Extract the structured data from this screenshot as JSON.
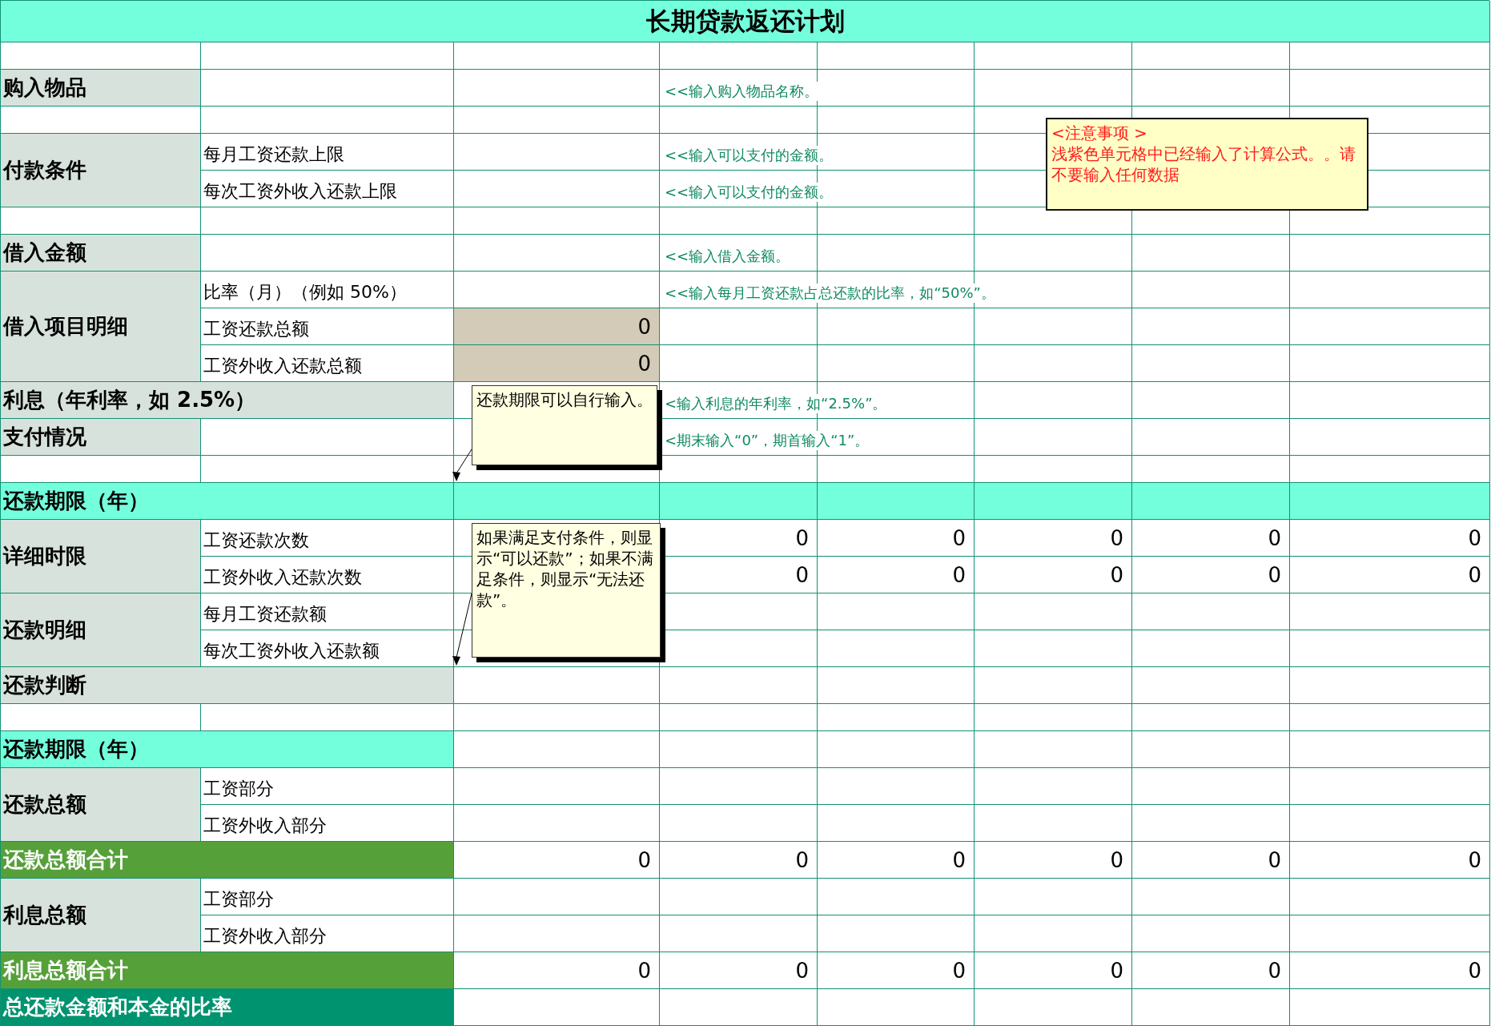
{
  "title": "长期贷款返还计划",
  "rows": [
    {
      "kind": "blank"
    },
    {
      "kind": "field",
      "label": "购入物品",
      "hint": "<<输入购入物品名称。"
    },
    {
      "kind": "blank"
    },
    {
      "kind": "group",
      "label": "付款条件",
      "items": [
        {
          "label": "每月工资还款上限",
          "hint": "<<输入可以支付的金额。"
        },
        {
          "label": "每次工资外收入还款上限",
          "hint": "<<输入可以支付的金额。"
        }
      ]
    },
    {
      "kind": "blank"
    },
    {
      "kind": "field",
      "label": "借入金额",
      "hint": "<<输入借入金额。"
    },
    {
      "kind": "group",
      "label": "借入项目明细",
      "items": [
        {
          "label": "比率（月）（例如 50%）",
          "hint": "<<输入每月工资还款占总还款的比率，如“50%”。"
        },
        {
          "label": "工资还款总额",
          "value": "0",
          "formula": true
        },
        {
          "label": "工资外收入还款总额",
          "value": "0",
          "formula": true
        }
      ]
    },
    {
      "kind": "wide",
      "label": "利息（年利率，如 2.5%）",
      "hint": "<输入利息的年利率，如“2.5%”。"
    },
    {
      "kind": "field",
      "label": "支付情况",
      "hint": "<期末输入“0”，期首输入“1”。"
    },
    {
      "kind": "blank"
    },
    {
      "kind": "band",
      "label": "还款期限（年）",
      "full_width": true
    },
    {
      "kind": "group",
      "label": "详细时限",
      "items": [
        {
          "label": "工资还款次数",
          "values": [
            "0",
            "0",
            "0",
            "0",
            "0"
          ]
        },
        {
          "label": "工资外收入还款次数",
          "values": [
            "0",
            "0",
            "0",
            "0",
            "0"
          ]
        }
      ]
    },
    {
      "kind": "group",
      "label": "还款明细",
      "items": [
        {
          "label": "每月工资还款额"
        },
        {
          "label": "每次工资外收入还款额"
        }
      ]
    },
    {
      "kind": "wide",
      "label": "还款判断"
    },
    {
      "kind": "blank"
    },
    {
      "kind": "band",
      "label": "还款期限（年）",
      "full_width": false
    },
    {
      "kind": "group",
      "label": "还款总额",
      "items": [
        {
          "label": "工资部分"
        },
        {
          "label": "工资外收入部分"
        }
      ]
    },
    {
      "kind": "total",
      "label": "还款总额合计",
      "values": [
        "0",
        "0",
        "0",
        "0",
        "0",
        "0"
      ]
    },
    {
      "kind": "group",
      "label": "利息总额",
      "items": [
        {
          "label": "工资部分"
        },
        {
          "label": "工资外收入部分"
        }
      ]
    },
    {
      "kind": "total",
      "label": "利息总额合计",
      "values": [
        "0",
        "0",
        "0",
        "0",
        "0",
        "0"
      ]
    },
    {
      "kind": "ratio",
      "label": "总还款金额和本金的比率"
    }
  ],
  "notes": [
    {
      "kind": "warning",
      "title": "<注意事项 >",
      "text": "浅紫色单元格中已经输入了计算公式。。请不要输入任何数据"
    },
    {
      "kind": "tip",
      "text": "还款期限可以自行输入。"
    },
    {
      "kind": "tip",
      "text": "如果满足支付条件，则显示“可以还款”；如果不满足条件，则显示“无法还款”。"
    }
  ]
}
